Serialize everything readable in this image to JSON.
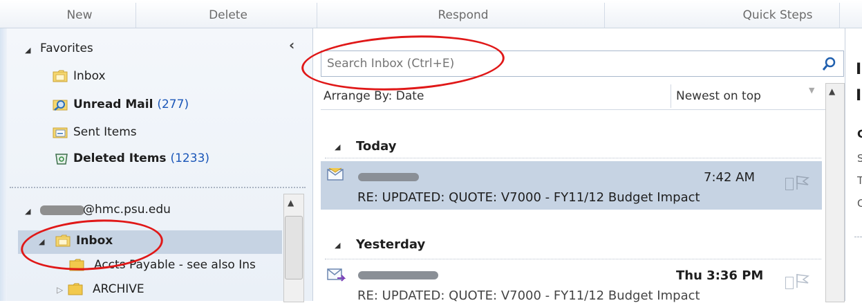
{
  "ribbon": {
    "groups": [
      "New",
      "Delete",
      "Respond",
      "Quick Steps"
    ]
  },
  "folders": {
    "favorites_label": "Favorites",
    "favorites": [
      {
        "label": "Inbox",
        "count": ""
      },
      {
        "label": "Unread Mail",
        "count": "(277)"
      },
      {
        "label": "Sent Items",
        "count": ""
      },
      {
        "label": "Deleted Items",
        "count": "(1233)"
      }
    ],
    "account": "@hmc.psu.edu",
    "account_folders": [
      {
        "label": "Inbox"
      },
      {
        "label": "Accts Payable - see also Ins"
      },
      {
        "label": "ARCHIVE"
      }
    ],
    "collapse_glyph": "‹"
  },
  "search": {
    "placeholder": "Search Inbox (Ctrl+E)"
  },
  "arrange": {
    "by": "Arrange By: Date",
    "order": "Newest on top"
  },
  "groups": [
    {
      "label": "Today"
    },
    {
      "label": "Yesterday"
    }
  ],
  "messages": [
    {
      "time": "7:42 AM",
      "subject": "RE: UPDATED: QUOTE: V7000 - FY11/12 Budget Impact"
    },
    {
      "time": "Thu 3:36 PM",
      "subject": "RE: UPDATED: QUOTE: V7000 - FY11/12 Budget Impact"
    }
  ],
  "reading_pane": {
    "letters": [
      "I",
      "I",
      "C",
      "S",
      "T",
      "C"
    ]
  },
  "colors": {
    "selected_row": "#c6d3e3",
    "annotation_red": "#e01818",
    "count_blue": "#1a56b8"
  }
}
